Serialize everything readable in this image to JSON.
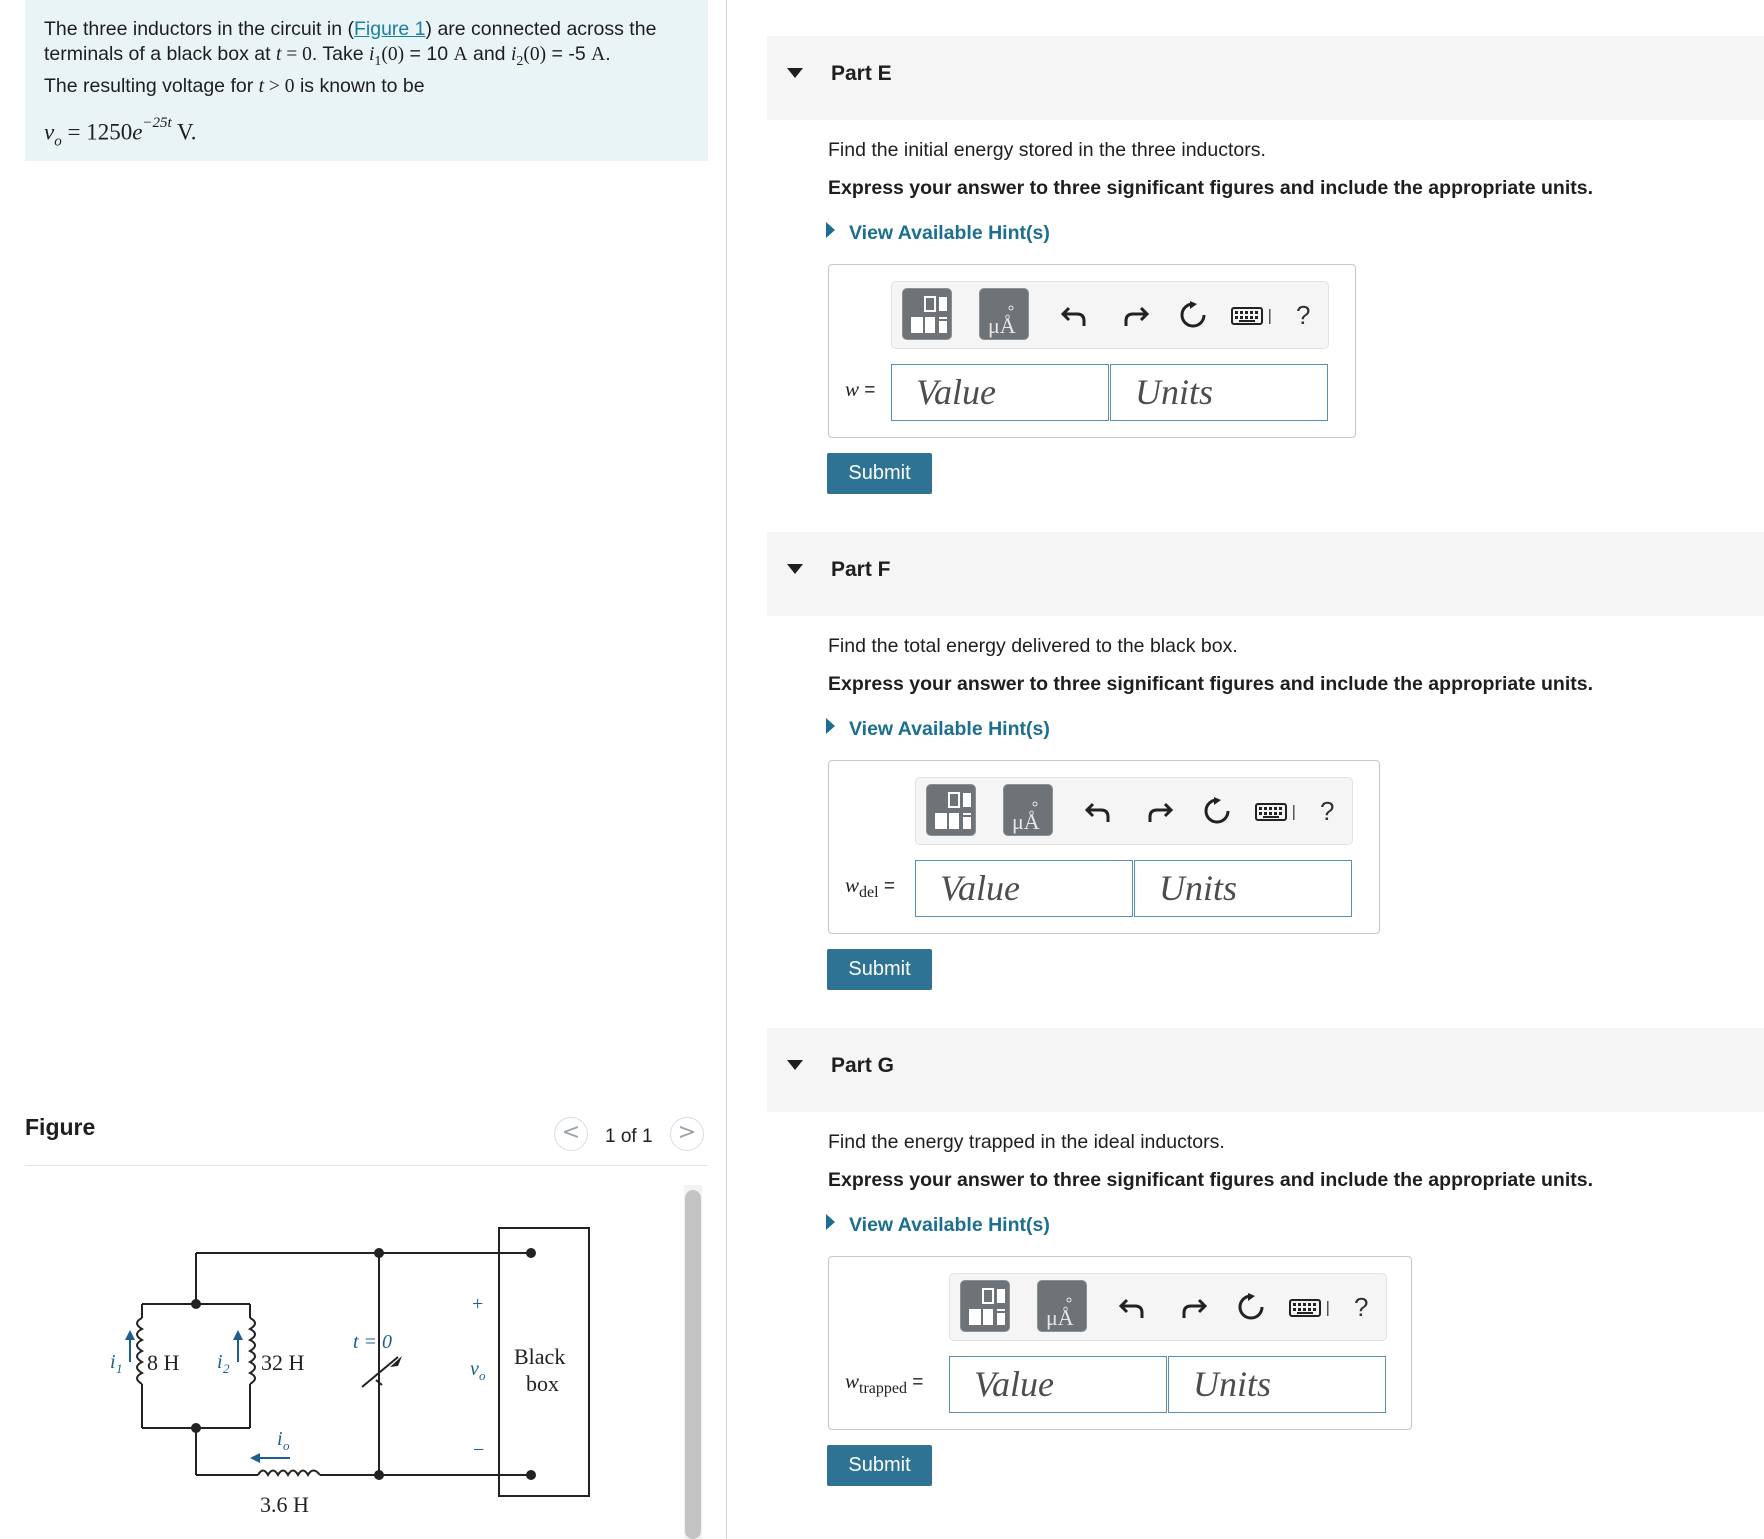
{
  "problem": {
    "text_1": "The three inductors in the circuit in (",
    "figure_link": "Figure 1",
    "text_2": ") are connected across the",
    "line2_a": "terminals of a black box at ",
    "t_var": "t",
    "eq": " = ",
    "zero": "0",
    "line2_b": ". Take ",
    "i1": "i",
    "i1_sub": "1",
    "i1_arg": "(0)",
    "i1_val": " = 10 ",
    "unit_A": "A",
    "and": " and ",
    "i2": "i",
    "i2_sub": "2",
    "i2_arg": "(0)",
    "i2_val": " = -5 ",
    "period": ".",
    "line3_a": "The resulting voltage for ",
    "gt": " > ",
    "line3_b": " is known to be",
    "vo_var": "v",
    "vo_sub": "o",
    "vo_rhs": " = 1250",
    "e": "e",
    "exp": "−25t",
    "vo_unit": " V."
  },
  "figure": {
    "title": "Figure",
    "pager": "1 of 1",
    "prev": "<",
    "next": ">",
    "labels": {
      "l1": "8 H",
      "l2": "32 H",
      "l3": "3.6 H",
      "i1": "i",
      "i1_sub": "1",
      "i2": "i",
      "i2_sub": "2",
      "io": "i",
      "io_sub": "o",
      "switch": "t = 0",
      "plus": "+",
      "minus": "−",
      "vo": "v",
      "vo_sub": "o",
      "box_line1": "Black",
      "box_line2": "box"
    }
  },
  "parts": [
    {
      "title": "Part E",
      "question": "Find the initial energy stored in the three inductors.",
      "instruction": "Express your answer to three significant figures and include the appropriate units.",
      "hint": "View Available Hint(s)",
      "var": "w",
      "var_sub": "",
      "equals": " =",
      "value_placeholder": "Value",
      "units_placeholder": "Units",
      "submit": "Submit",
      "help": "?"
    },
    {
      "title": "Part F",
      "question": "Find the total energy delivered to the black box.",
      "instruction": "Express your answer to three significant figures and include the appropriate units.",
      "hint": "View Available Hint(s)",
      "var": "w",
      "var_sub": "del",
      "equals": " =",
      "value_placeholder": "Value",
      "units_placeholder": "Units",
      "submit": "Submit",
      "help": "?"
    },
    {
      "title": "Part G",
      "question": "Find the energy trapped in the ideal inductors.",
      "instruction": "Express your answer to three significant figures and include the appropriate units.",
      "hint": "View Available Hint(s)",
      "var": "w",
      "var_sub": "trapped",
      "equals": " =",
      "value_placeholder": "Value",
      "units_placeholder": "Units",
      "submit": "Submit",
      "help": "?"
    }
  ],
  "toolbar_icons": [
    "templates-icon",
    "units-icon",
    "undo-icon",
    "redo-icon",
    "reset-icon",
    "keyboard-icon",
    "help-icon"
  ],
  "colors": {
    "accent": "#2e7394",
    "link": "#1b6f8f",
    "problem_bg": "#e8f4f6"
  }
}
